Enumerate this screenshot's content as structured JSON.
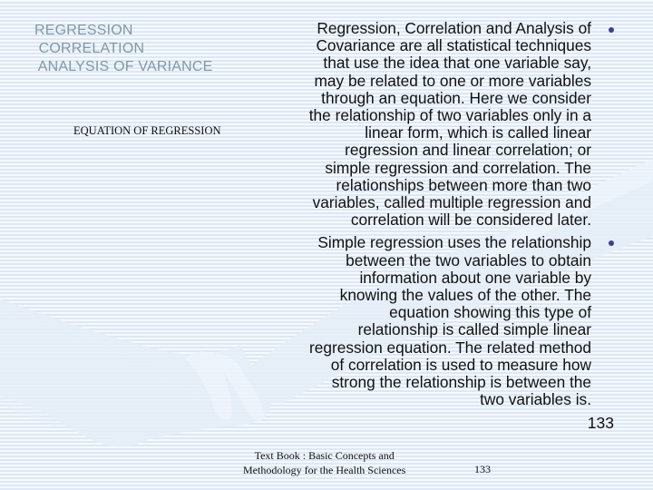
{
  "slide": {
    "topics": [
      "REGRESSION",
      " CORRELATION",
      " ANALYSIS OF VARIANCE"
    ],
    "subtitle": "EQUATION OF REGRESSION",
    "paragraphs": [
      {
        "lines": [
          "Regression, Correlation and Analysis of",
          "Covariance are all statistical techniques",
          "that use the idea that one variable say,",
          "may be related to one or more variables",
          "through an equation. Here we consider",
          "the relationship of two variables only in a",
          "linear form, which is called linear",
          "regression and linear correlation; or",
          "simple regression and correlation. The",
          "relationships between more than two",
          "variables, called multiple regression and",
          "correlation will be considered later."
        ]
      },
      {
        "lines": [
          "Simple regression uses the relationship",
          "between the two variables to obtain",
          "information about one variable by",
          "knowing the values of the other. The",
          "equation showing this type of",
          "relationship is called simple linear",
          "regression equation. The related method",
          "of correlation is used to measure how",
          "strong the relationship is between the",
          "two variables is."
        ]
      }
    ],
    "page_number": "133",
    "footer": {
      "line1": "Text Book :  Basic Concepts and",
      "line2": "Methodology for the Health Sciences",
      "page_number": "133"
    },
    "colors": {
      "topic_text": "#7f98a6",
      "bullet": "#3b3f98",
      "stripe_light": "#f6f9fd",
      "stripe_dark": "#dde8f5",
      "artwork": "#e8eff8"
    },
    "background_icon": "handshake-artwork"
  }
}
